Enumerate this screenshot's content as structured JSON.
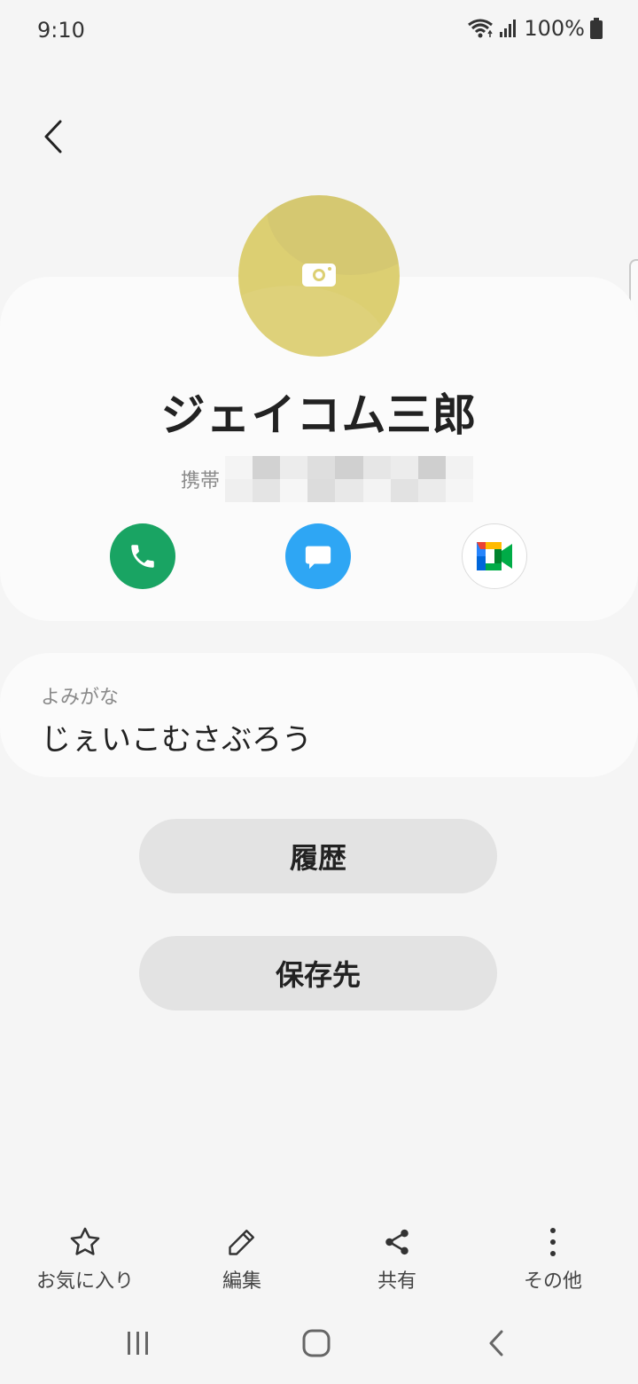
{
  "status_bar": {
    "time": "9:10",
    "battery": "100%",
    "icons": [
      "wifi-icon",
      "signal-icon",
      "battery-icon"
    ]
  },
  "header": {
    "back_icon": "chevron-left-icon"
  },
  "contact": {
    "avatar_icon": "camera-icon",
    "avatar_color": "#dccf72",
    "name": "ジェイコム三郎",
    "phone_label": "携帯",
    "phone_number_redacted": true
  },
  "actions": [
    {
      "name": "call",
      "icon": "phone-icon",
      "color": "#19a463"
    },
    {
      "name": "message",
      "icon": "message-icon",
      "color": "#2ea6f4"
    },
    {
      "name": "video",
      "icon": "google-meet-icon",
      "color": "#ffffff"
    }
  ],
  "furigana": {
    "label": "よみがな",
    "value": "じぇいこむさぶろう"
  },
  "buttons": {
    "history": "履歴",
    "storage": "保存先"
  },
  "toolbar": {
    "favorite": "お気に入り",
    "edit": "編集",
    "share": "共有",
    "more": "その他"
  },
  "navbar": [
    "recent-apps-icon",
    "home-icon",
    "back-icon"
  ]
}
